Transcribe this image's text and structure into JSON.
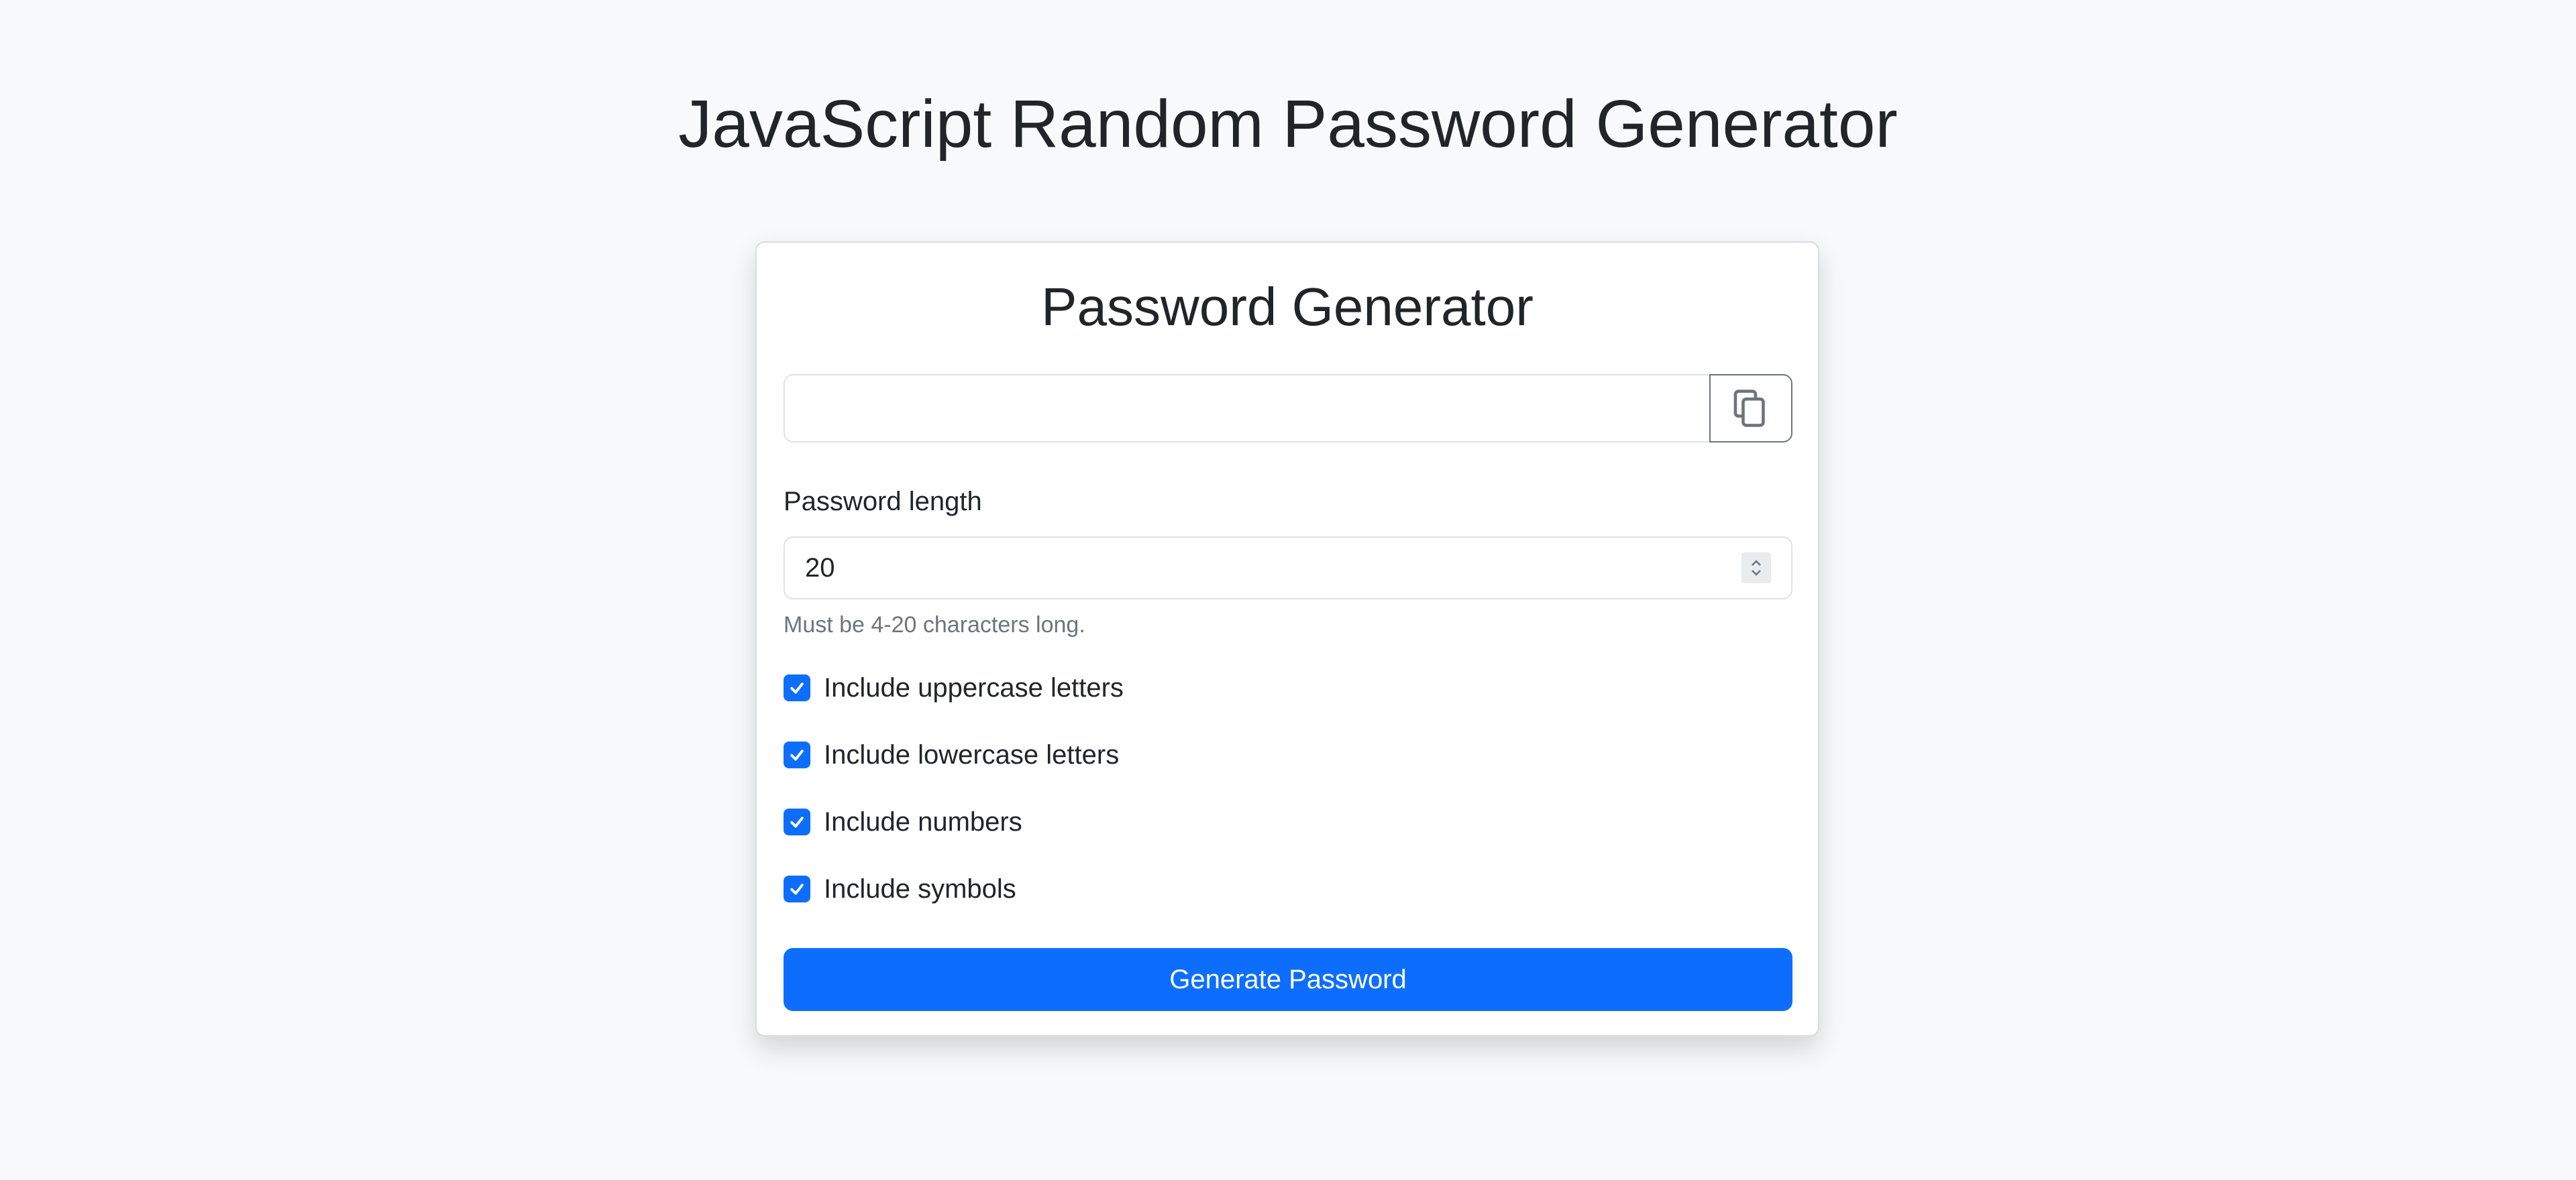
{
  "page": {
    "title": "JavaScript Random Password Generator"
  },
  "card": {
    "title": "Password Generator",
    "password": {
      "value": "",
      "placeholder": ""
    },
    "copy_button": {
      "icon": "copy-icon"
    },
    "length": {
      "label": "Password length",
      "value": "20",
      "help": "Must be 4-20 characters long."
    },
    "options": [
      {
        "label": "Include uppercase letters",
        "checked": true
      },
      {
        "label": "Include lowercase letters",
        "checked": true
      },
      {
        "label": "Include numbers",
        "checked": true
      },
      {
        "label": "Include symbols",
        "checked": true
      }
    ],
    "generate_label": "Generate Password"
  },
  "colors": {
    "background": "#f8f9fa",
    "primary": "#0d6efd",
    "text": "#212529",
    "muted": "#6c757d",
    "border": "#dee2e6"
  }
}
